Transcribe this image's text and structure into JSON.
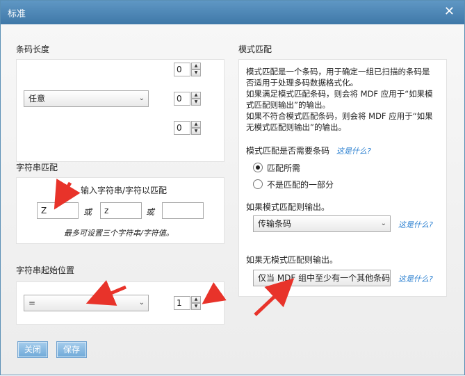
{
  "window": {
    "title": "标准",
    "close_glyph": "✕"
  },
  "barcode_length": {
    "label": "条码长度",
    "mode": "任意",
    "spinners": [
      "0",
      "0",
      "0"
    ]
  },
  "string_match": {
    "label": "字符串匹配",
    "instruction": "输入字符串/字符以匹配",
    "inputs": [
      "Z",
      "z",
      ""
    ],
    "or_label": "或",
    "note": "最多可设置三个字符串/字符值。"
  },
  "string_start": {
    "label": "字符串起始位置",
    "operator": "=",
    "value": "1"
  },
  "pattern": {
    "label": "模式匹配",
    "description": [
      "模式匹配是一个条码，用于确定一组已扫描的条码是",
      "否适用于处理多码数据格式化。",
      "如果满足模式匹配条码，则会将 MDF 应用于“如果模",
      "式匹配则输出”的输出。",
      "如果不符合模式匹配条码，则会将 MDF 应用于“如果",
      "无模式匹配则输出”的输出。"
    ],
    "required_label": "模式匹配是否需要条码",
    "whats_this": "这是什么?",
    "radio_match_all": "匹配所需",
    "radio_not_part": "不是匹配的一部分",
    "match_output_label": "如果模式匹配则输出。",
    "match_output_value": "传输条码",
    "nomatch_output_label": "如果无模式匹配则输出。",
    "nomatch_output_value": "仅当 MDF 组中至少有一个其他条码"
  },
  "buttons": {
    "close": "关闭",
    "save": "保存"
  },
  "colors": {
    "titlebar": "#4a85b6",
    "link": "#2a7fd0",
    "arrow": "#e8332a",
    "button": "#7fb3de"
  }
}
